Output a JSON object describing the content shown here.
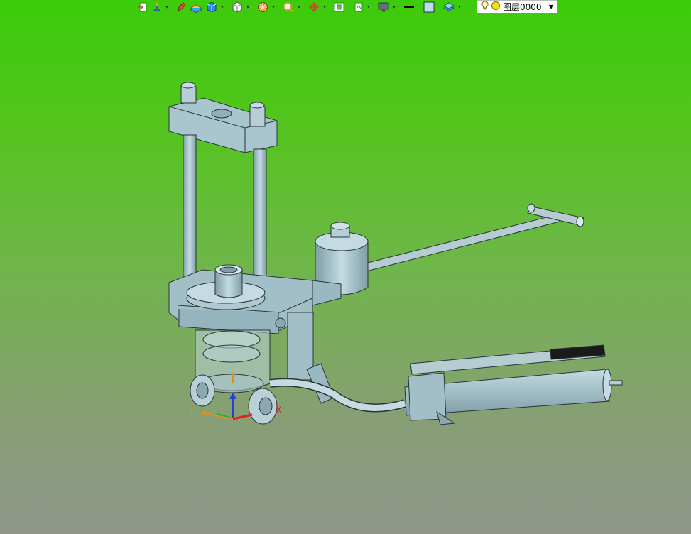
{
  "toolbar": {
    "buttons": [
      {
        "name": "new-part-icon",
        "has_dropdown": false
      },
      {
        "name": "anchor-icon",
        "has_dropdown": true
      },
      {
        "name": "pencil-icon",
        "has_dropdown": false
      },
      {
        "name": "extrude-icon",
        "has_dropdown": false
      },
      {
        "name": "cube-blue-icon",
        "has_dropdown": true
      },
      {
        "name": "cube-white-icon",
        "has_dropdown": true
      },
      {
        "name": "render-sphere-icon",
        "has_dropdown": true
      },
      {
        "name": "zoom-icon",
        "has_dropdown": true
      },
      {
        "name": "pan-rotate-icon",
        "has_dropdown": true
      },
      {
        "name": "fit-view-icon",
        "has_dropdown": false
      },
      {
        "name": "view-orient-icon",
        "has_dropdown": true
      },
      {
        "name": "display-monitor-icon",
        "has_dropdown": true
      },
      {
        "name": "line-color-icon",
        "has_dropdown": false
      },
      {
        "name": "fill-color-icon",
        "has_dropdown": false
      },
      {
        "name": "layer-stack-icon",
        "has_dropdown": true
      }
    ],
    "line_color": "#000000",
    "fill_color": "#b8dcf0"
  },
  "layer": {
    "name": "图层0000"
  },
  "triad": {
    "x_label": "X",
    "y_label": "Y",
    "x_color": "#e02020",
    "y_color": "#20b020",
    "z_color": "#2040e0",
    "origin_color": "#e09020"
  },
  "model": {
    "metal_color": "#a7c3cc",
    "edge_color": "#2a3438",
    "grip_color": "#1a1a1a"
  },
  "background": {
    "top": "#3ccc0a",
    "bottom": "#90978a"
  }
}
